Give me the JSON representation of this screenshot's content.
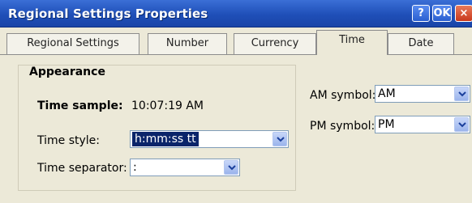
{
  "window": {
    "title": "Regional Settings Properties",
    "help_label": "?",
    "ok_label": "OK",
    "close_label": "×"
  },
  "tabs": [
    {
      "label": "Regional Settings",
      "active": false
    },
    {
      "label": "Number",
      "active": false
    },
    {
      "label": "Currency",
      "active": false
    },
    {
      "label": "Time",
      "active": true
    },
    {
      "label": "Date",
      "active": false
    }
  ],
  "appearance": {
    "group_label": "Appearance",
    "sample_label": "Time sample:",
    "sample_value": "10:07:19 AM",
    "style_label": "Time style:",
    "style_value": "h:mm:ss tt",
    "separator_label": "Time separator:",
    "separator_value": ":"
  },
  "symbols": {
    "am_label": "AM symbol:",
    "am_value": "AM",
    "pm_label": "PM symbol:",
    "pm_value": "PM"
  },
  "colors": {
    "titlebar": "#1f4fb8",
    "selection": "#0a246a",
    "background": "#ece9d8"
  }
}
